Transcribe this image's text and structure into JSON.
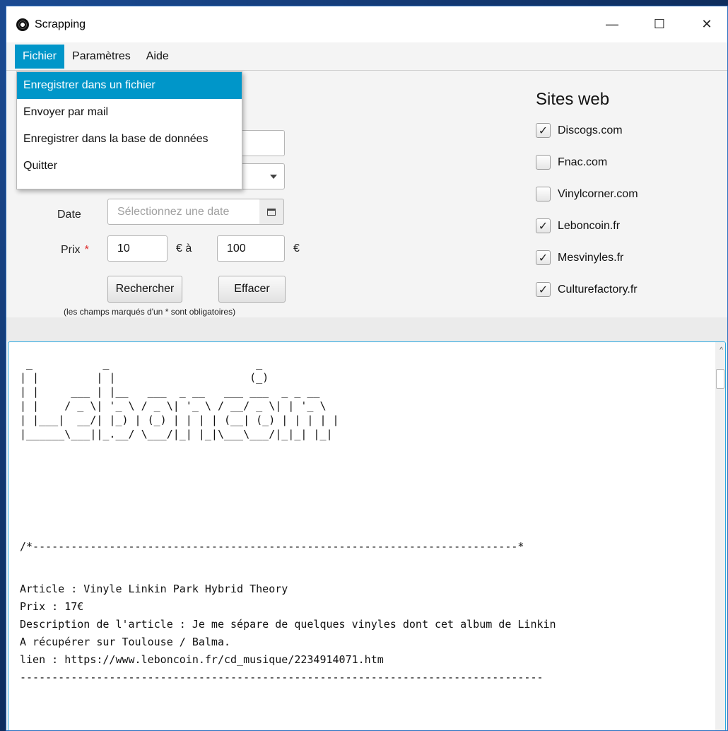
{
  "window": {
    "title": "Scrapping"
  },
  "window_controls": {
    "minimize": "—",
    "maximize": "☐",
    "close": "✕"
  },
  "menu": {
    "items": [
      "Fichier",
      "Paramètres",
      "Aide"
    ]
  },
  "dropdown": {
    "items": [
      "Enregistrer dans un fichier",
      "Envoyer par mail",
      "Enregistrer dans la base de données",
      "Quitter"
    ]
  },
  "form": {
    "date_label": "Date",
    "date_placeholder": "Sélectionnez une date",
    "prix_label": "Prix",
    "required_mark": "*",
    "prix_min": "10",
    "prix_between": "€ à",
    "prix_max": "100",
    "currency": "€",
    "search_button": "Rechercher",
    "clear_button": "Effacer",
    "note": "(les champs marqués d'un * sont obligatoires)"
  },
  "sites": {
    "title": "Sites web",
    "items": [
      {
        "label": "Discogs.com",
        "checked": true
      },
      {
        "label": "Fnac.com",
        "checked": false
      },
      {
        "label": "Vinylcorner.com",
        "checked": false
      },
      {
        "label": "Leboncoin.fr",
        "checked": true
      },
      {
        "label": "Mesvinyles.fr",
        "checked": true
      },
      {
        "label": "Culturefactory.fr",
        "checked": true
      }
    ]
  },
  "output": {
    "ascii_banner": " _           _                       _       \n| |         | |                     (_)      \n| |     ___ | |__   ___  _ __   ___ ___  _ _ __  \n| |    / _ \\| '_ \\ / _ \\| '_ \\ / __/ _ \\| | '_ \\ \n| |___|  __/| |_) | (_) | | | | (__| (_) | | | | |\n|______\\___||_.__/ \\___/|_| |_|\\___\\___/|_|_| |_|",
    "separator_top": "/*----------------------------------------------------------------------------*",
    "lines": [
      "Article : Vinyle Linkin Park Hybrid Theory",
      "Prix : 17€",
      "Description de l'article : Je me sépare de quelques vinyles dont cet album de Linkin",
      "A récupérer sur Toulouse / Balma.",
      "lien : https://www.leboncoin.fr/cd_musique/2234914071.htm"
    ],
    "separator_bottom": "----------------------------------------------------------------------------------"
  }
}
